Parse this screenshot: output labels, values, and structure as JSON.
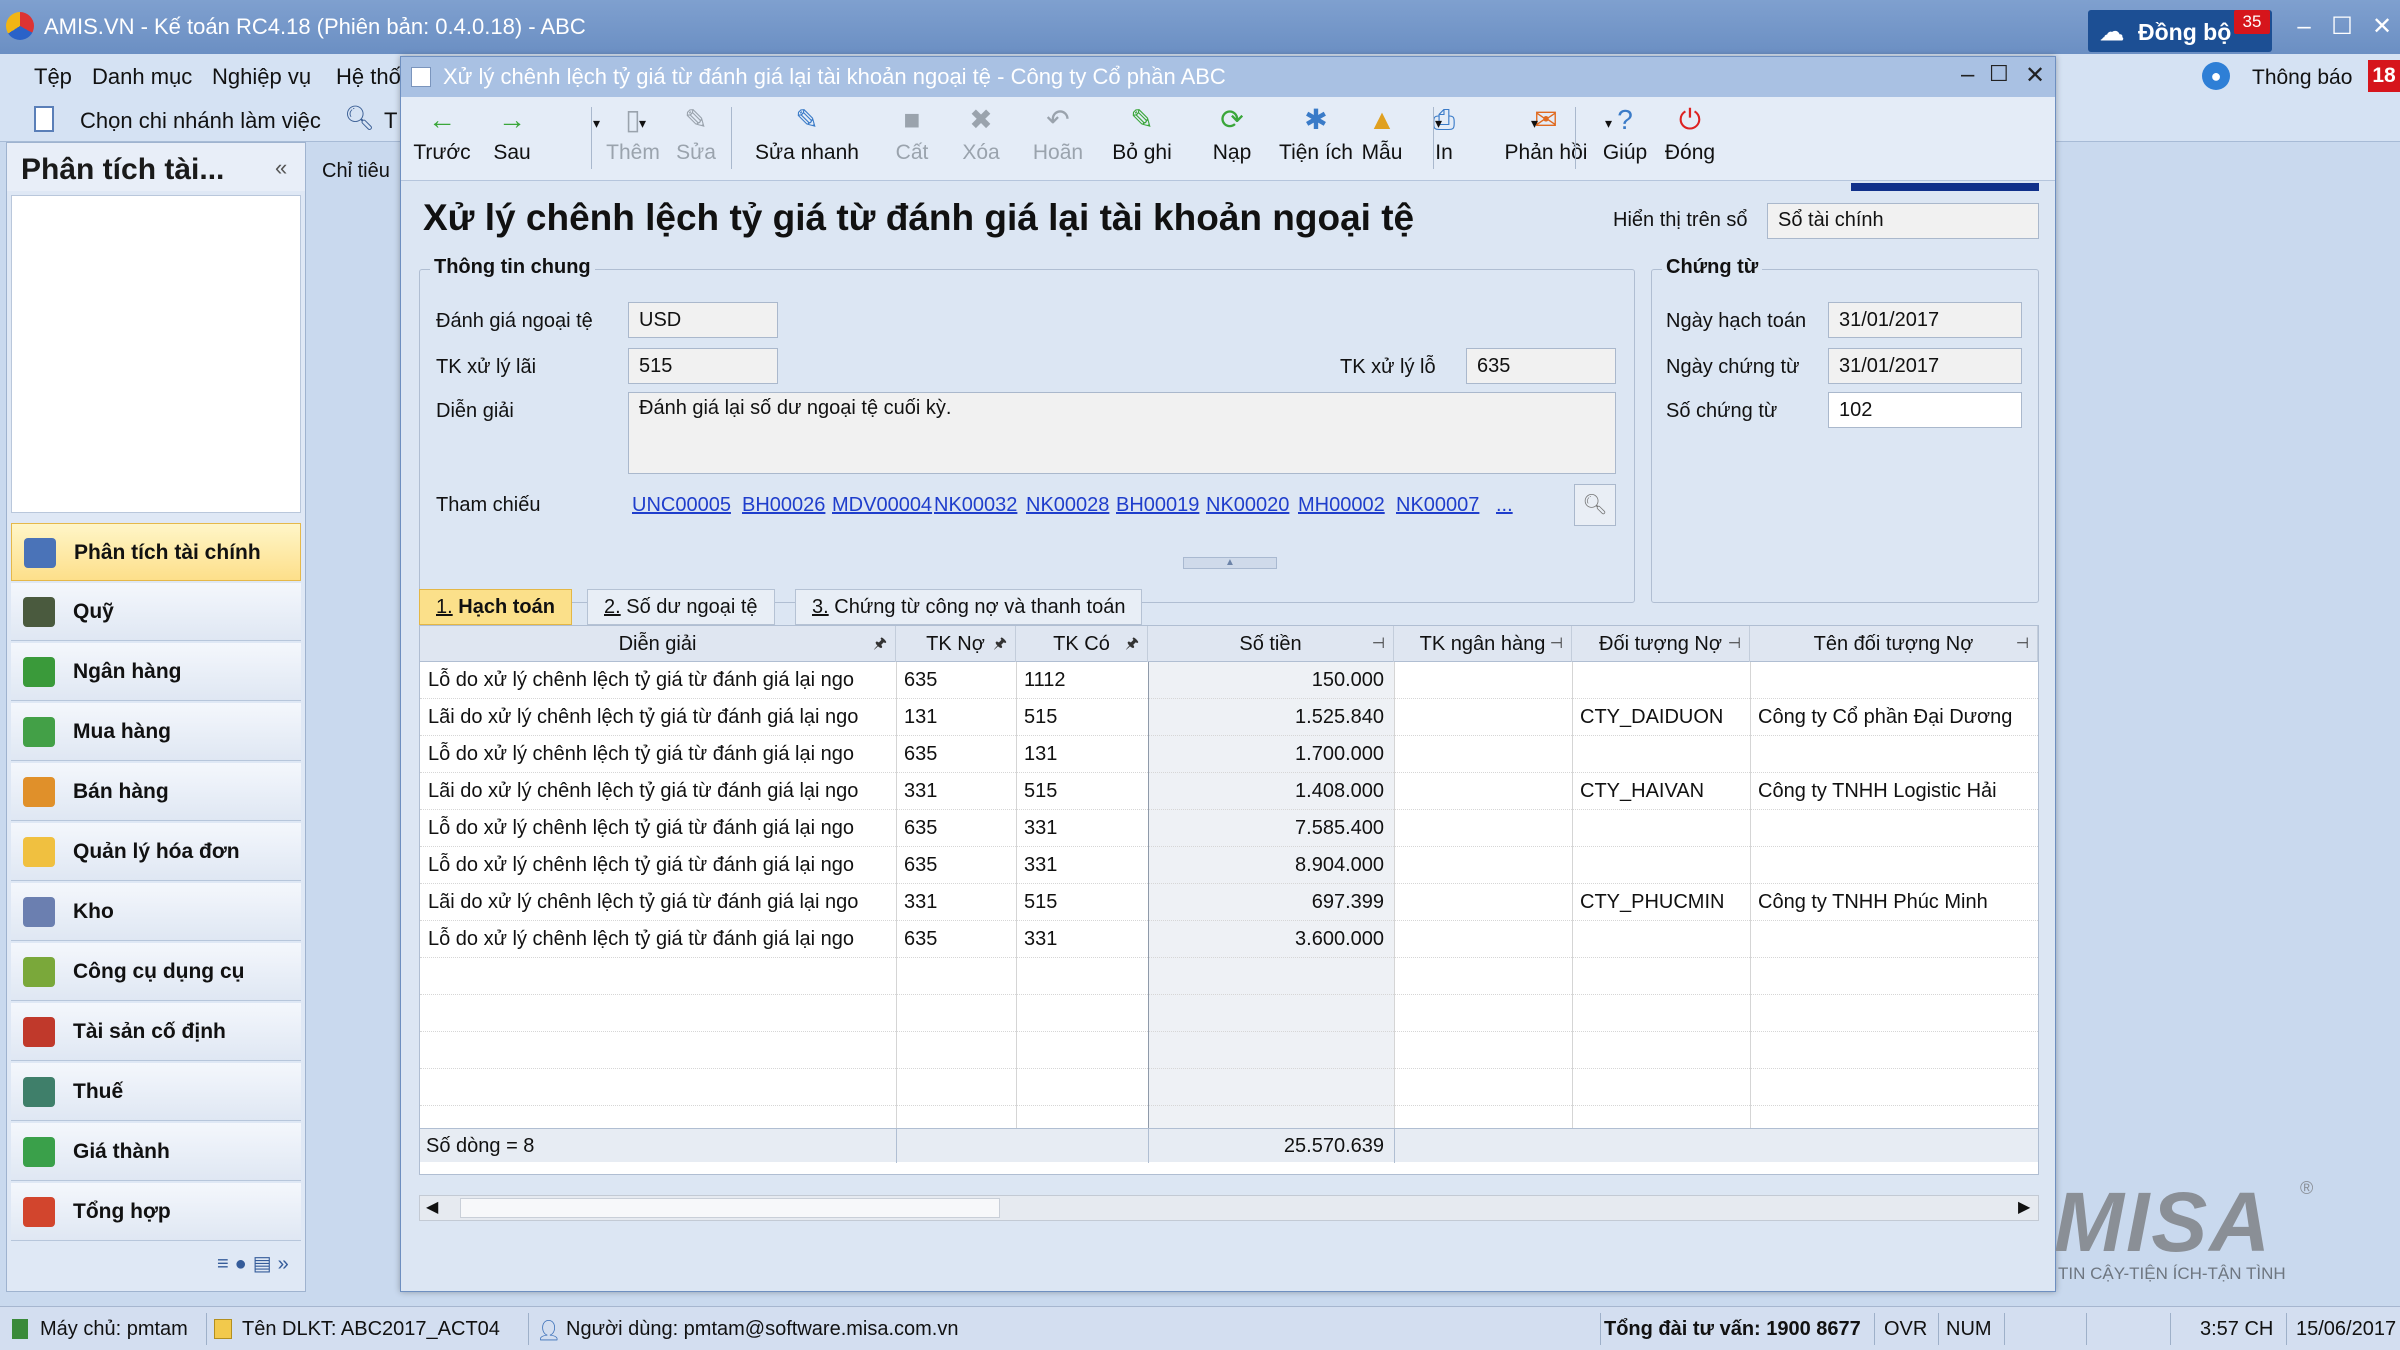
{
  "app": {
    "title": "AMIS.VN - Kế toán RC4.18 (Phiên bản: 0.4.0.18) - ABC",
    "sync_label": "Đồng bộ",
    "sync_count": "35",
    "notify_label": "Thông báo",
    "notify_count": "18"
  },
  "menu": [
    "Tệp",
    "Danh mục",
    "Nghiệp vụ",
    "Hệ thố"
  ],
  "subbar": {
    "branch": "Chọn chi nhánh làm việc",
    "search_stub": "T"
  },
  "left_panel": {
    "title": "Phân tích tài...",
    "items": [
      {
        "label": "Phân tích tài chính",
        "color": "#4a73b8"
      },
      {
        "label": "Quỹ",
        "color": "#4a5a3e"
      },
      {
        "label": "Ngân hàng",
        "color": "#3a9a3a"
      },
      {
        "label": "Mua hàng",
        "color": "#43a047"
      },
      {
        "label": "Bán hàng",
        "color": "#e0902a"
      },
      {
        "label": "Quản lý hóa đơn",
        "color": "#f0c040"
      },
      {
        "label": "Kho",
        "color": "#6b7fb0"
      },
      {
        "label": "Công cụ dụng cụ",
        "color": "#7aa83a"
      },
      {
        "label": "Tài sản cố định",
        "color": "#c0392b"
      },
      {
        "label": "Thuế",
        "color": "#3f7f6a"
      },
      {
        "label": "Giá thành",
        "color": "#3aa04a"
      },
      {
        "label": "Tổng hợp",
        "color": "#d2452d"
      }
    ]
  },
  "behind_tab": "Chỉ tiêu",
  "child": {
    "title": "Xử lý chênh lệch tỷ giá từ đánh giá lại tài khoản ngoại tệ - Công ty Cổ phần ABC",
    "toolbar": [
      {
        "label": "Trước",
        "icon": "←",
        "enabled": true,
        "color": "#3aa63a"
      },
      {
        "label": "Sau",
        "icon": "→",
        "enabled": true,
        "color": "#3aa63a"
      },
      {
        "label": "Thêm",
        "icon": "▯",
        "enabled": false,
        "color": "#9aa3ad"
      },
      {
        "label": "Sửa",
        "icon": "✎",
        "enabled": false,
        "color": "#9aa3ad"
      },
      {
        "label": "Sửa nhanh",
        "icon": "✎",
        "enabled": true,
        "color": "#3a7bc8"
      },
      {
        "label": "Cất",
        "icon": "■",
        "enabled": false,
        "color": "#9aa3ad"
      },
      {
        "label": "Xóa",
        "icon": "✖",
        "enabled": false,
        "color": "#9aa3ad"
      },
      {
        "label": "Hoãn",
        "icon": "↶",
        "enabled": false,
        "color": "#9aa3ad"
      },
      {
        "label": "Bỏ ghi",
        "icon": "✎",
        "enabled": true,
        "color": "#3aa63a"
      },
      {
        "label": "Nạp",
        "icon": "⟳",
        "enabled": true,
        "color": "#3aa63a"
      },
      {
        "label": "Tiện ích",
        "icon": "✱",
        "enabled": true,
        "color": "#3a7bc8"
      },
      {
        "label": "Mẫu",
        "icon": "▲",
        "enabled": true,
        "color": "#e0a020"
      },
      {
        "label": "In",
        "icon": "⎙",
        "enabled": true,
        "color": "#3a7bc8"
      },
      {
        "label": "Phản hồi",
        "icon": "✉",
        "enabled": true,
        "color": "#e06a20"
      },
      {
        "label": "Giúp",
        "icon": "?",
        "enabled": true,
        "color": "#3a7bc8"
      },
      {
        "label": "Đóng",
        "icon": "⏻",
        "enabled": true,
        "color": "#d22"
      }
    ],
    "form_title": "Xử lý chênh lệch tỷ giá từ đánh giá lại tài khoản ngoại tệ",
    "display_on_label": "Hiển thị trên sổ",
    "display_on_value": "Sổ tài chính",
    "general": {
      "group_title": "Thông tin chung",
      "currency_label": "Đánh giá ngoại tệ",
      "currency_value": "USD",
      "gain_label": "TK xử lý lãi",
      "gain_value": "515",
      "loss_label": "TK xử lý lỗ",
      "loss_value": "635",
      "desc_label": "Diễn giải",
      "desc_value": "Đánh giá lại số dư ngoại tệ cuối kỳ.",
      "ref_label": "Tham chiếu",
      "refs": [
        "UNC00005",
        "BH00026",
        "MDV00004",
        "NK00032",
        "NK00028",
        "BH00019",
        "NK00020",
        "MH00002",
        "NK00007",
        "..."
      ]
    },
    "voucher": {
      "group_title": "Chứng từ",
      "posting_date_label": "Ngày hạch toán",
      "posting_date": "31/01/2017",
      "voucher_date_label": "Ngày chứng từ",
      "voucher_date": "31/01/2017",
      "voucher_no_label": "Số chứng từ",
      "voucher_no": "102"
    },
    "tabs": [
      {
        "num": "1.",
        "label": "Hạch toán",
        "active": true
      },
      {
        "num": "2.",
        "label": "Số dư ngoại tệ",
        "active": false
      },
      {
        "num": "3.",
        "label": "Chứng từ công nợ và thanh toán",
        "active": false
      }
    ],
    "grid": {
      "columns": [
        "Diễn giải",
        "TK Nợ",
        "TK Có",
        "Số tiền",
        "TK ngân hàng",
        "Đối tượng Nợ",
        "Tên đối tượng Nợ"
      ],
      "rows": [
        [
          "Lỗ do xử lý chênh lệch tỷ giá từ đánh giá lại ngo",
          "635",
          "1112",
          "150.000",
          "",
          "",
          ""
        ],
        [
          "Lãi do xử lý chênh lệch tỷ giá từ đánh giá lại ngo",
          "131",
          "515",
          "1.525.840",
          "",
          "CTY_DAIDUON",
          "Công ty Cổ phần Đại Dương"
        ],
        [
          "Lỗ do xử lý chênh lệch tỷ giá từ đánh giá lại ngo",
          "635",
          "131",
          "1.700.000",
          "",
          "",
          ""
        ],
        [
          "Lãi do xử lý chênh lệch tỷ giá từ đánh giá lại ngo",
          "331",
          "515",
          "1.408.000",
          "",
          "CTY_HAIVAN",
          "Công ty TNHH Logistic Hải"
        ],
        [
          "Lỗ do xử lý chênh lệch tỷ giá từ đánh giá lại ngo",
          "635",
          "331",
          "7.585.400",
          "",
          "",
          ""
        ],
        [
          "Lỗ do xử lý chênh lệch tỷ giá từ đánh giá lại ngo",
          "635",
          "331",
          "8.904.000",
          "",
          "",
          ""
        ],
        [
          "Lãi do xử lý chênh lệch tỷ giá từ đánh giá lại ngo",
          "331",
          "515",
          "697.399",
          "",
          "CTY_PHUCMIN",
          "Công ty TNHH Phúc Minh"
        ],
        [
          "Lỗ do xử lý chênh lệch tỷ giá từ đánh giá lại ngo",
          "635",
          "331",
          "3.600.000",
          "",
          "",
          ""
        ]
      ],
      "row_count_label": "Số dòng = 8",
      "total": "25.570.639"
    }
  },
  "status": {
    "server": "Máy chủ: pmtam",
    "db": "Tên DLKT: ABC2017_ACT04",
    "user": "Người dùng: pmtam@software.misa.com.vn",
    "hotline": "Tổng đài tư vấn: 1900 8677",
    "ovr": "OVR",
    "num": "NUM",
    "time": "3:57 CH",
    "date": "15/06/2017"
  },
  "logo": {
    "brand": "MISA",
    "tagline": "TIN CẬY-TIỆN ÍCH-TẬN TÌNH",
    "reg": "®"
  }
}
